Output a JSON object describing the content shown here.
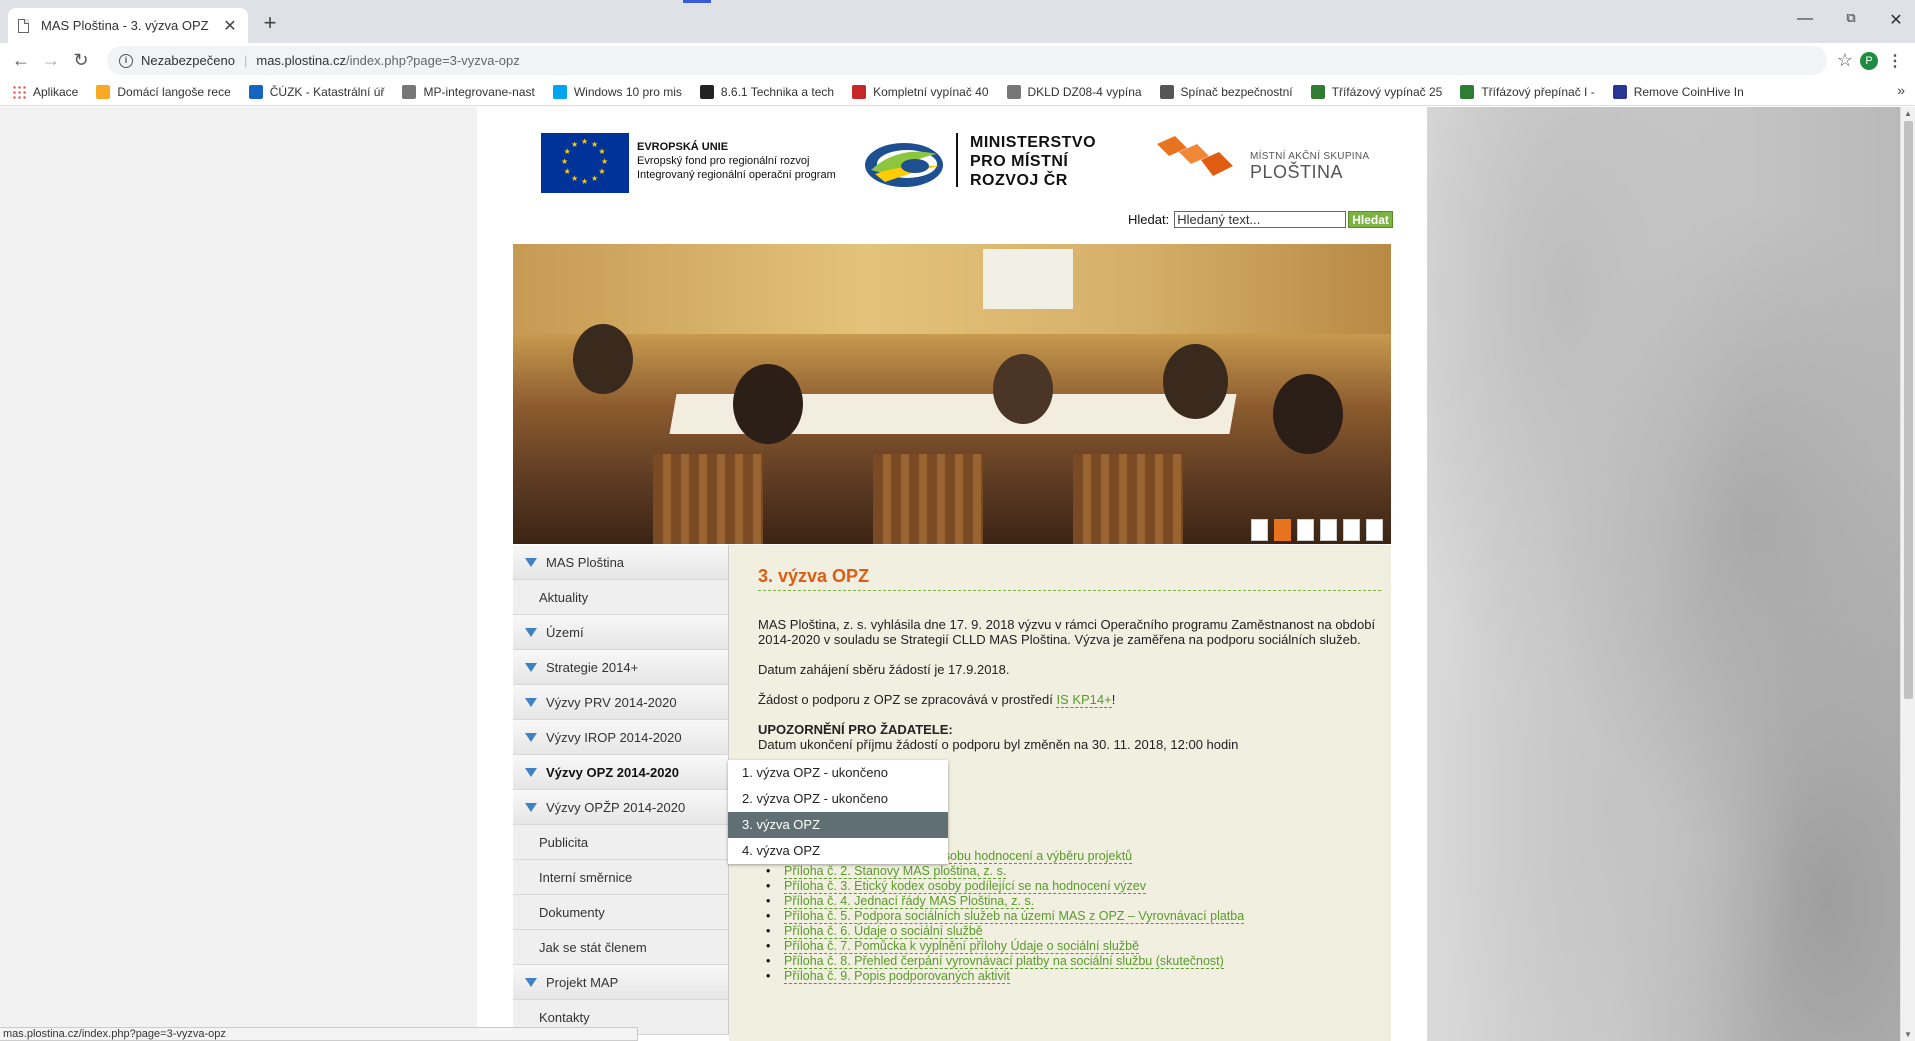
{
  "browser": {
    "tab_title": "MAS Ploština - 3. výzva OPZ",
    "tab_close": "✕",
    "new_tab": "+",
    "insecure_label": "Nezabezpečeno",
    "url_host": "mas.plostina.cz",
    "url_path": "/index.php?page=3-vyzva-opz",
    "profile_initial": "P",
    "status_url": "mas.plostina.cz/index.php?page=3-vyzva-opz"
  },
  "bookmarks": [
    {
      "label": "Aplikace",
      "icon": "apps-grid-icon"
    },
    {
      "label": "Domácí langoše rece",
      "icon": "bookmark-favicon"
    },
    {
      "label": "ČÚZK - Katastrální úř",
      "icon": "bookmark-favicon"
    },
    {
      "label": "MP-integrovane-nast",
      "icon": "page-icon"
    },
    {
      "label": "Windows 10 pro mis",
      "icon": "windows-icon"
    },
    {
      "label": "8.6.1 Technika a tech",
      "icon": "bookmark-favicon"
    },
    {
      "label": "Kompletní vypínač 40",
      "icon": "bookmark-favicon"
    },
    {
      "label": "DKLD DZ08-4 vypína",
      "icon": "page-icon"
    },
    {
      "label": "Spínač bezpečnostní",
      "icon": "bookmark-favicon"
    },
    {
      "label": "Třífázový vypínač 25",
      "icon": "bookmark-favicon"
    },
    {
      "label": "Třífázový přepínač I -",
      "icon": "bookmark-favicon"
    },
    {
      "label": "Remove CoinHive In",
      "icon": "bookmark-favicon"
    }
  ],
  "header": {
    "eu_title": "EVROPSKÁ UNIE",
    "eu_line1": "Evropský fond pro regionální rozvoj",
    "eu_line2": "Integrovaný regionální operační program",
    "mmr_line1": "MINISTERSTVO",
    "mmr_line2": "PRO MÍSTNÍ",
    "mmr_line3": "ROZVOJ ČR",
    "mas_small": "MÍSTNÍ AKČNÍ SKUPINA",
    "mas_big": "PLOŠTINA"
  },
  "search": {
    "label": "Hledat:",
    "value": "Hledaný text...",
    "button": "Hledat"
  },
  "banner": {
    "active_slide": 2,
    "slide_count": 6
  },
  "nav": [
    {
      "label": "MAS Ploština",
      "arrow": true
    },
    {
      "label": "Aktuality",
      "arrow": false
    },
    {
      "label": "Území",
      "arrow": true
    },
    {
      "label": "Strategie 2014+",
      "arrow": true
    },
    {
      "label": "Výzvy PRV 2014-2020",
      "arrow": true
    },
    {
      "label": "Výzvy IROP 2014-2020",
      "arrow": true
    },
    {
      "label": "Výzvy OPZ 2014-2020",
      "arrow": true
    },
    {
      "label": "Výzvy OPŽP 2014-2020",
      "arrow": true
    },
    {
      "label": "Publicita",
      "arrow": false
    },
    {
      "label": "Interní směrnice",
      "arrow": false
    },
    {
      "label": "Dokumenty",
      "arrow": false
    },
    {
      "label": "Jak se stát členem",
      "arrow": false
    },
    {
      "label": "Projekt MAP",
      "arrow": true
    },
    {
      "label": "Kontakty",
      "arrow": false
    }
  ],
  "content": {
    "title": "3. výzva OPZ",
    "p1": "MAS Ploština, z. s. vyhlásila dne 17. 9. 2018 výzvu v rámci Operačního programu Zaměstnanost na období 2014-2020 v souladu se Strategií CLLD MAS Ploština. Výzva je zaměřena na podporu sociálních služeb.",
    "p2": "Datum zahájení sběru žádostí je 17.9.2018.",
    "p3_pre": "Žádost o podporu z OPZ se zpracovává v prostředí ",
    "p3_link": "IS KP14+",
    "p3_post": "!",
    "warn_title": "UPOZORNĚNÍ PRO ŽADATELE:",
    "warn_text": "Datum ukončení příjmu žádostí o podporu byl změněn na 30. 11. 2018, 12:00 hodin",
    "annexes": [
      "Příloha č. 1. Informace o způsobu hodnocení a výběru projektů",
      "Příloha č. 2. Stanovy MAS ploština, z. s.",
      "Příloha č. 3. Etický kodex osoby podílející se na hodnocení výzev",
      "Příloha č. 4. Jednací řády MAS Ploština, z. s.",
      "Příloha č. 5. Podpora sociálních služeb na území MAS z OPZ – Vyrovnávací platba",
      "Příloha č. 6. Údaje o sociální službě",
      "Příloha č. 7. Pomůcka k vyplnění přílohy Údaje o sociální službě",
      "Příloha č. 8. Přehled čerpání vyrovnávací platby na sociální službu (skutečnost)",
      "Příloha č. 9. Popis podporovaných aktivit"
    ]
  },
  "dropdown": [
    {
      "label": "1. výzva OPZ - ukončeno",
      "selected": false
    },
    {
      "label": "2. výzva OPZ - ukončeno",
      "selected": false
    },
    {
      "label": "3. výzva OPZ",
      "selected": true
    },
    {
      "label": "4. výzva OPZ",
      "selected": false
    }
  ],
  "colors": {
    "accent_orange": "#e05c12",
    "link_green": "#5a9a2a",
    "nav_arrow": "#3f82c4"
  }
}
